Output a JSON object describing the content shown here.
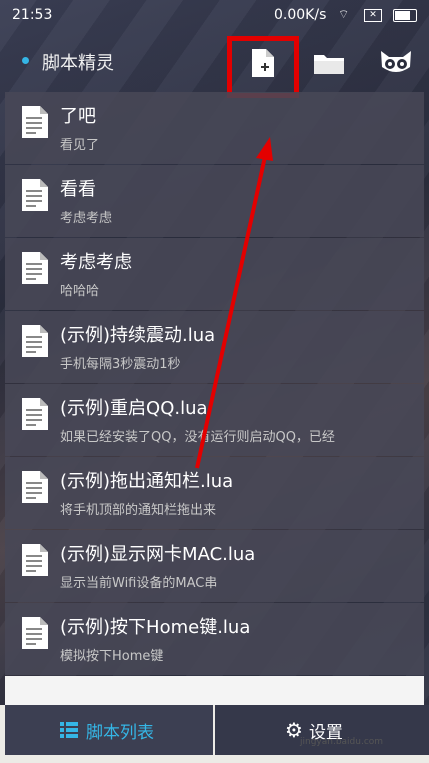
{
  "status": {
    "time": "21:53",
    "speed": "0.00K/s"
  },
  "appbar": {
    "title": "脚本精灵",
    "icons": [
      "new-file-icon",
      "folder-icon",
      "owl-icon"
    ]
  },
  "scripts": [
    {
      "title": "了吧",
      "subtitle": "看见了"
    },
    {
      "title": "看看",
      "subtitle": "考虑考虑"
    },
    {
      "title": "考虑考虑",
      "subtitle": "哈哈哈"
    },
    {
      "title": "(示例)持续震动.lua",
      "subtitle": "手机每隔3秒震动1秒"
    },
    {
      "title": "(示例)重启QQ.lua",
      "subtitle": "如果已经安装了QQ，没有运行则启动QQ，已经"
    },
    {
      "title": "(示例)拖出通知栏.lua",
      "subtitle": "将手机顶部的通知栏拖出来"
    },
    {
      "title": "(示例)显示网卡MAC.lua",
      "subtitle": "显示当前Wifi设备的MAC串"
    },
    {
      "title": "(示例)按下Home键.lua",
      "subtitle": "模拟按下Home键"
    }
  ],
  "tabs": {
    "list_label": "脚本列表",
    "settings_label": "设置"
  },
  "watermark": "jingyan.baidu.com",
  "colors": {
    "accent": "#35b6e6",
    "highlight": "#e30000"
  }
}
